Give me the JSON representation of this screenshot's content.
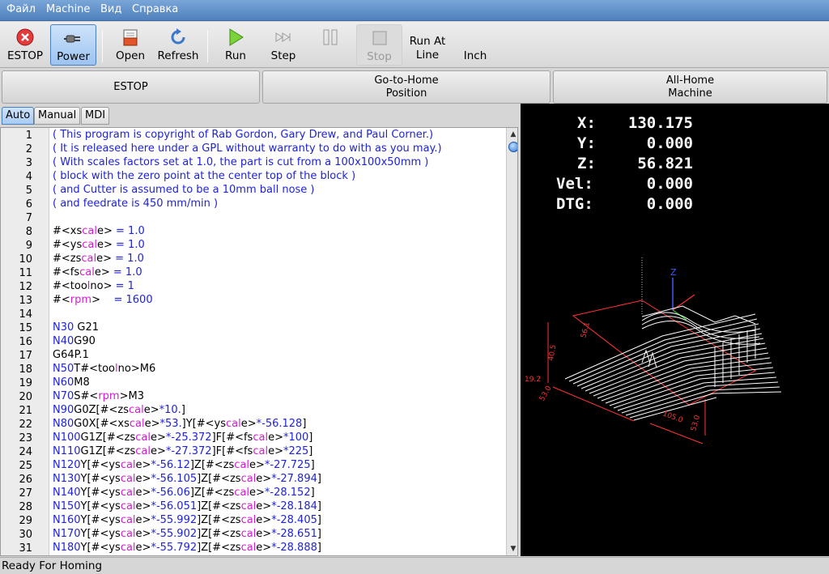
{
  "menu": [
    "Файл",
    "Machine",
    "Вид",
    "Справка"
  ],
  "toolbar": {
    "estop": "ESTOP",
    "power": "Power",
    "open": "Open",
    "refresh": "Refresh",
    "run": "Run",
    "step": "Step",
    "stop": "Stop",
    "run_at_line": "Run At\nLine",
    "inch": "Inch"
  },
  "buttons": {
    "estop": "ESTOP",
    "goto_home": "Go-to-Home\nPosition",
    "all_home": "All-Home\nMachine"
  },
  "tabs": [
    "Auto",
    "Manual",
    "MDI"
  ],
  "editor": {
    "line_numbers": [
      "1",
      "2",
      "3",
      "4",
      "5",
      "6",
      "7",
      "8",
      "9",
      "10",
      "11",
      "12",
      "13",
      "14",
      "15",
      "16",
      "17",
      "18",
      "19",
      "20",
      "21",
      "22",
      "23",
      "24",
      "25",
      "26",
      "27",
      "28",
      "29",
      "30",
      "31"
    ],
    "lines": [
      "( This program is copyright of Rab Gordon, Gary Drew, and Paul Corner.)",
      "( It is released here under a GPL without warranty to do with as you may.)",
      "( With scales factors set at 1.0, the part is cut from a 100x100x50mm )",
      "( block with the zero point at the center top of the block )",
      "( and Cutter is assumed to be a 10mm ball nose )",
      "( and feedrate is 450 mm/min )",
      "",
      "#<xscale> = 1.0",
      "#<yscale> = 1.0",
      "#<zscale> = 1.0",
      "#<fscale> = 1.0",
      "#<toolno> = 1",
      "#<rpm>    = 1600",
      "",
      "N30 G21",
      "N40G90",
      "G64P.1",
      "N50T#<toolno>M6",
      "N60M8",
      "N70S#<rpm>M3",
      "N90G0Z[#<zscale>*10.]",
      "N80G0X[#<xscale>*53.]Y[#<yscale>*-56.128]",
      "N100G1Z[#<zscale>*-25.372]F[#<fscale>*100]",
      "N110G1Z[#<zscale>*-27.372]F[#<fscale>*225]",
      "N120Y[#<yscale>*-56.12]Z[#<zscale>*-27.725]",
      "N130Y[#<yscale>*-56.105]Z[#<zscale>*-27.894]",
      "N140Y[#<yscale>*-56.06]Z[#<zscale>*-28.152]",
      "N150Y[#<yscale>*-56.051]Z[#<zscale>*-28.184]",
      "N160Y[#<yscale>*-55.992]Z[#<zscale>*-28.405]",
      "N170Y[#<yscale>*-55.902]Z[#<zscale>*-28.651]",
      "N180Y[#<yscale>*-55.792]Z[#<zscale>*-28.888]"
    ]
  },
  "dro": {
    "x_label": "X:",
    "x": "130.175",
    "y_label": "Y:",
    "y": "0.000",
    "z_label": "Z:",
    "z": "56.821",
    "vel_label": "Vel:",
    "vel": "0.000",
    "dtg_label": "DTG:",
    "dtg": "0.000"
  },
  "preview_labels": {
    "z_axis": "Z",
    "dim_x": "105.0",
    "dim_y": "53.0",
    "dim_a": "53.0",
    "dim_b": "40.5",
    "dim_c": "56.1",
    "dim_d": "19.2"
  },
  "status": "Ready For Homing",
  "colors": {
    "menubar": "#4f81bd",
    "comment": "#1f23d6",
    "param": "#d41bd4",
    "preview_bg": "#000000",
    "dim_red": "#ff3333",
    "toolpath": "#ffffff"
  }
}
